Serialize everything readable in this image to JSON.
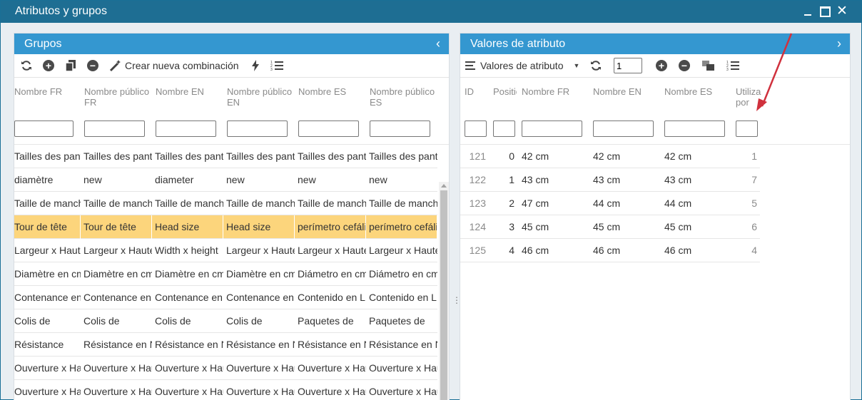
{
  "window": {
    "title": "Atributos y grupos"
  },
  "left": {
    "title": "Grupos",
    "toolbar": {
      "create_label": "Crear nueva combinación"
    },
    "columns": [
      "Nombre FR",
      "Nombre público FR",
      "Nombre EN",
      "Nombre público EN",
      "Nombre ES",
      "Nombre público ES"
    ],
    "rows": [
      [
        "Tailles des pantalons",
        "Tailles des pantalons",
        "Tailles des pantalons",
        "Tailles des pantalons",
        "Tailles des pantalons",
        "Tailles des pantalons"
      ],
      [
        "diamètre",
        "new",
        "diameter",
        "new",
        "new",
        "new"
      ],
      [
        "Taille de manche",
        "Taille de manche",
        "Taille de manche",
        "Taille de manche",
        "Taille de manche",
        "Taille de manche"
      ],
      [
        "Tour de tête",
        "Tour de tête",
        "Head size",
        "Head size",
        "perímetro cefálico",
        "perímetro cefálico"
      ],
      [
        "Largeur x Hauteur",
        "Largeur x Hauteur",
        "Width x height",
        "Largeur x Hauteur",
        "Largeur x Hauteur",
        "Largeur x Hauteur"
      ],
      [
        "Diamètre en cm",
        "Diamètre en cm",
        "Diamètre en cm",
        "Diamètre en cm",
        "Diámetro en cm",
        "Diámetro en cm"
      ],
      [
        "Contenance en L",
        "Contenance en L",
        "Contenance en L",
        "Contenance en L",
        "Contenido en L",
        "Contenido en L"
      ],
      [
        "Colis de",
        "Colis de",
        "Colis de",
        "Colis de",
        "Paquetes de",
        "Paquetes de"
      ],
      [
        "Résistance",
        "Résistance en N",
        "Résistance en N",
        "Résistance en N",
        "Résistance en N",
        "Résistance en N"
      ],
      [
        "Ouverture x Hauteur",
        "Ouverture x Hauteur",
        "Ouverture x Hauteur",
        "Ouverture x Hauteur",
        "Ouverture x Hauteur",
        "Ouverture x Hauteur"
      ],
      [
        "Ouverture x Hauteur",
        "Ouverture x Hauteur",
        "Ouverture x Hauteur",
        "Ouverture x Hauteur",
        "Ouverture x Hauteur",
        "Ouverture x Hauteur"
      ]
    ],
    "selected_row": 3
  },
  "right": {
    "title": "Valores de atributo",
    "toolbar": {
      "dropdown_label": "Valores de atributo",
      "page_value": "1"
    },
    "columns": [
      "ID",
      "Positio",
      "Nombre FR",
      "Nombre EN",
      "Nombre ES",
      "Utiliza por"
    ],
    "rows": [
      [
        "121",
        "0",
        "42 cm",
        "42 cm",
        "42 cm",
        "1"
      ],
      [
        "122",
        "1",
        "43 cm",
        "43 cm",
        "43 cm",
        "7"
      ],
      [
        "123",
        "2",
        "47 cm",
        "44 cm",
        "44 cm",
        "5"
      ],
      [
        "124",
        "3",
        "45 cm",
        "45 cm",
        "45 cm",
        "6"
      ],
      [
        "125",
        "4",
        "46 cm",
        "46 cm",
        "46 cm",
        "4"
      ]
    ]
  },
  "colors": {
    "titlebar": "#1e6e93",
    "panel_header": "#3497d0",
    "selected_row": "#fcd57c",
    "annotation_arrow": "#d0313d"
  }
}
